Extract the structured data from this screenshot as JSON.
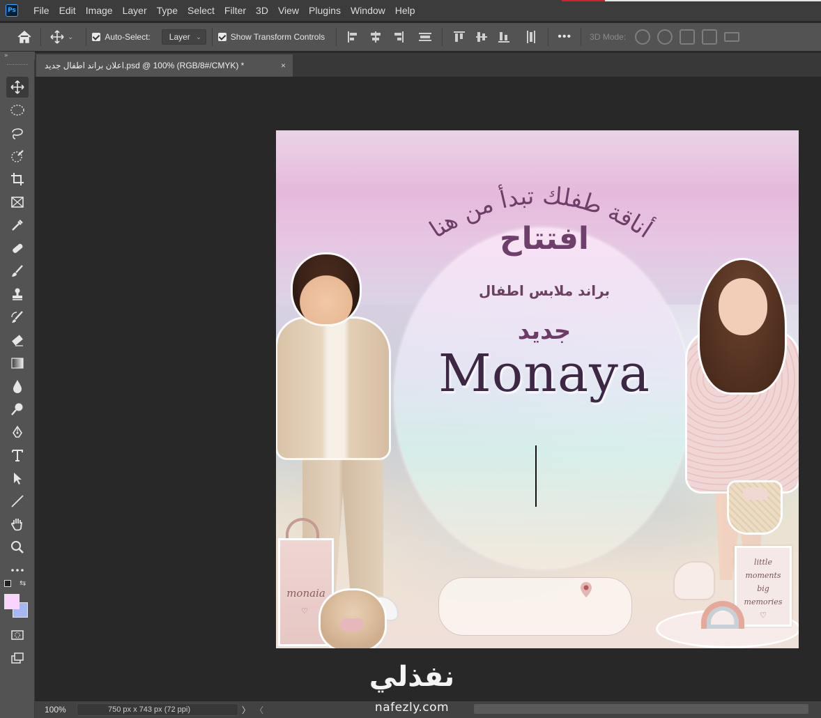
{
  "app": {
    "logo_text": "Ps",
    "menu": [
      "File",
      "Edit",
      "Image",
      "Layer",
      "Type",
      "Select",
      "Filter",
      "3D",
      "View",
      "Plugins",
      "Window",
      "Help"
    ]
  },
  "options_bar": {
    "auto_select_label": "Auto-Select:",
    "auto_select_checked": true,
    "layer_select_value": "Layer",
    "show_transform_label": "Show Transform Controls",
    "show_transform_checked": true,
    "mode_3d_label": "3D Mode:"
  },
  "panel_toggle": "»",
  "document_tab": {
    "title": "اعلان براند اطفال جديد.psd @ 100% (RGB/8#/CMYK) *",
    "close_symbol": "×"
  },
  "tools": [
    "move-tool",
    "elliptical-marquee-tool",
    "lasso-tool",
    "object-selection-tool",
    "crop-tool",
    "frame-tool",
    "eyedropper-tool",
    "spot-healing-brush-tool",
    "brush-tool",
    "clone-stamp-tool",
    "history-brush-tool",
    "eraser-tool",
    "gradient-tool",
    "blur-tool",
    "dodge-tool",
    "pen-tool",
    "type-tool",
    "path-selection-tool",
    "line-tool",
    "hand-tool",
    "zoom-tool",
    "edit-toolbar"
  ],
  "colors": {
    "foreground": "#fbd3ff",
    "background": "#a8b7f2",
    "accent_text": "#6e3f6a",
    "brand_text": "#3d2745"
  },
  "artwork": {
    "arc_tagline": "أناقة طفلك تبدأ من هنا",
    "opening": "افتتاح",
    "brand_line": "براند ملابس اطفال",
    "new_label": "جديد",
    "brand_name": "Monaya",
    "bag_label": "monaia",
    "bag_heart": "♡",
    "sign_text": "little\nmoments\nbig\nmemories\n♡"
  },
  "status_bar": {
    "zoom": "100%",
    "doc_info": "750 px x 743 px (72 ppi)",
    "arrow": "〉",
    "left_arrow": "〈"
  },
  "watermark": {
    "arabic": "نفذلي",
    "latin": "nafezly.com"
  }
}
